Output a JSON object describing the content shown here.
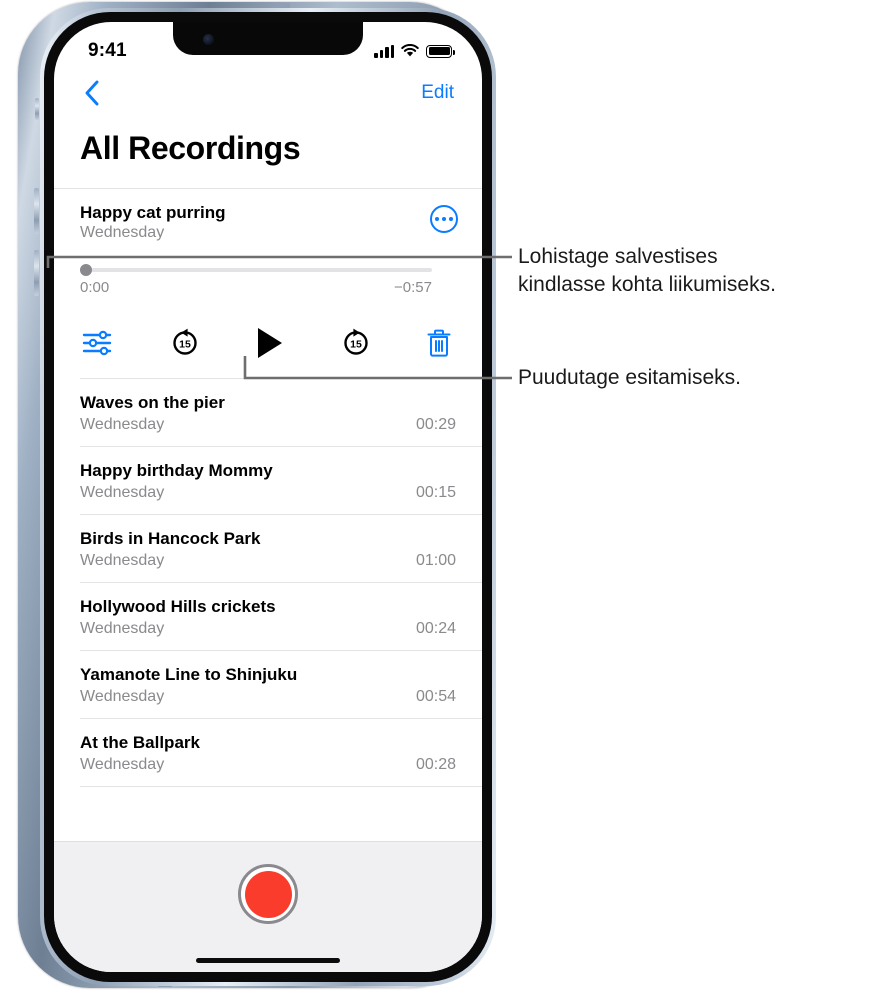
{
  "status_bar": {
    "time": "9:41",
    "cellular_icon": "cellular-bars-icon",
    "wifi_icon": "wifi-icon",
    "battery_icon": "battery-full-icon"
  },
  "nav": {
    "back_icon": "chevron-left-icon",
    "edit_label": "Edit"
  },
  "page": {
    "title": "All Recordings"
  },
  "expanded_recording": {
    "title": "Happy cat purring",
    "date": "Wednesday",
    "more_icon": "ellipsis-circle-icon",
    "current_time": "0:00",
    "remaining_time": "−0:57",
    "progress_percent": 0,
    "controls": {
      "edit_icon": "sliders-icon",
      "skip_back_label": "15",
      "skip_back_icon": "skip-back-15-icon",
      "play_icon": "play-icon",
      "skip_forward_label": "15",
      "skip_forward_icon": "skip-forward-15-icon",
      "delete_icon": "trash-icon"
    }
  },
  "recordings": [
    {
      "title": "Waves on the pier",
      "date": "Wednesday",
      "duration": "00:29"
    },
    {
      "title": "Happy birthday Mommy",
      "date": "Wednesday",
      "duration": "00:15"
    },
    {
      "title": "Birds in Hancock Park",
      "date": "Wednesday",
      "duration": "01:00"
    },
    {
      "title": "Hollywood Hills crickets",
      "date": "Wednesday",
      "duration": "00:24"
    },
    {
      "title": "Yamanote Line to Shinjuku",
      "date": "Wednesday",
      "duration": "00:54"
    },
    {
      "title": "At the Ballpark",
      "date": "Wednesday",
      "duration": "00:28"
    }
  ],
  "toolbar": {
    "record_icon": "record-button-icon"
  },
  "callouts": [
    {
      "text": "Lohistage salvestises\nkindlasse kohta liikumiseks."
    },
    {
      "text": "Puudutage esitamiseks."
    }
  ],
  "colors": {
    "accent_blue": "#0a7cff",
    "record_red": "#fa3c2d",
    "secondary_text": "#8a8a8e",
    "separator": "#e4e4e6",
    "toolbar_bg": "#f0f0f3",
    "callout_line": "#6e6e6e"
  }
}
